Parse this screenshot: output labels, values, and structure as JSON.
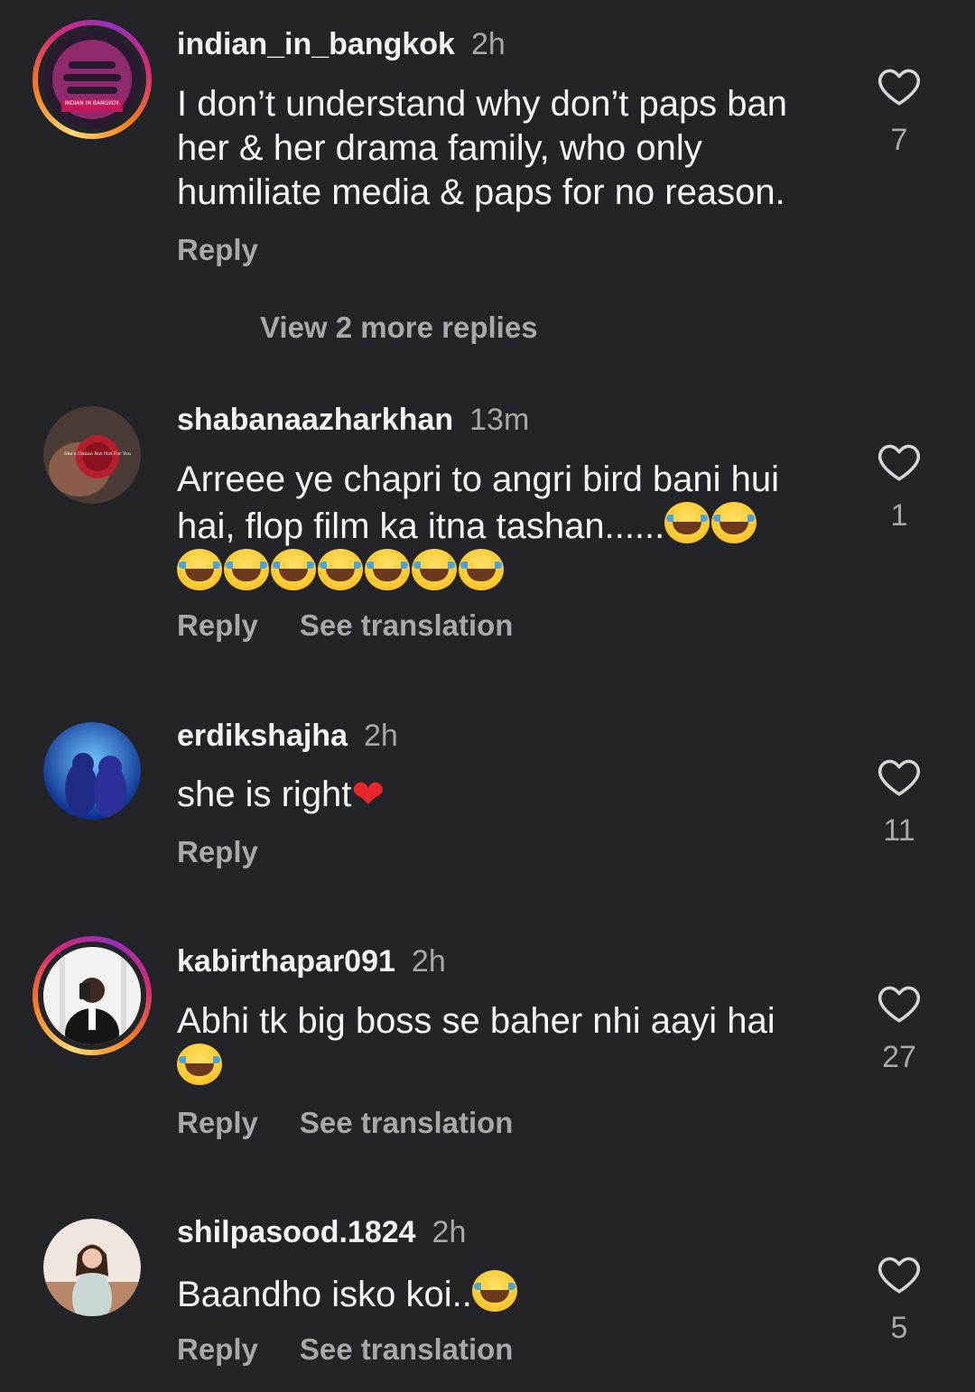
{
  "comments": [
    {
      "username": "indian_in_bangkok",
      "time": "2h",
      "text": "I don’t understand why don’t paps ban her & her drama family, who only humiliate media & paps for no reason.",
      "likes": "7",
      "reply_label": "Reply",
      "avatar_text": "INDIAN IN BANGKOK"
    },
    {
      "username": "shabanaazharkhan",
      "time": "13m",
      "text": "Arreee ye chapri to angri bird bani hui hai, flop film ka itna tashan......",
      "likes": "1",
      "reply_label": "Reply",
      "translate_label": "See translation",
      "avatar_text": "She's Online But Not For You"
    },
    {
      "username": "erdikshajha",
      "time": "2h",
      "text": "she is right",
      "likes": "11",
      "reply_label": "Reply"
    },
    {
      "username": "kabirthapar091",
      "time": "2h",
      "text": "Abhi tk big boss  se baher nhi aayi hai",
      "likes": "27",
      "reply_label": "Reply",
      "translate_label": "See translation"
    },
    {
      "username": "shilpasood.1824",
      "time": "2h",
      "text": "Baandho isko koi..",
      "likes": "5",
      "reply_label": "Reply",
      "translate_label": "See translation"
    }
  ],
  "view_more_replies": "View 2 more replies",
  "icons": {
    "like": "heart-outline-icon",
    "emoji_laugh": "face-with-tears-of-joy",
    "emoji_heart": "red-heart"
  },
  "colors": {
    "background": "#232428",
    "text_primary": "#f5f5f5",
    "text_secondary": "#a8a8a8",
    "story_ring": "#d62976"
  }
}
